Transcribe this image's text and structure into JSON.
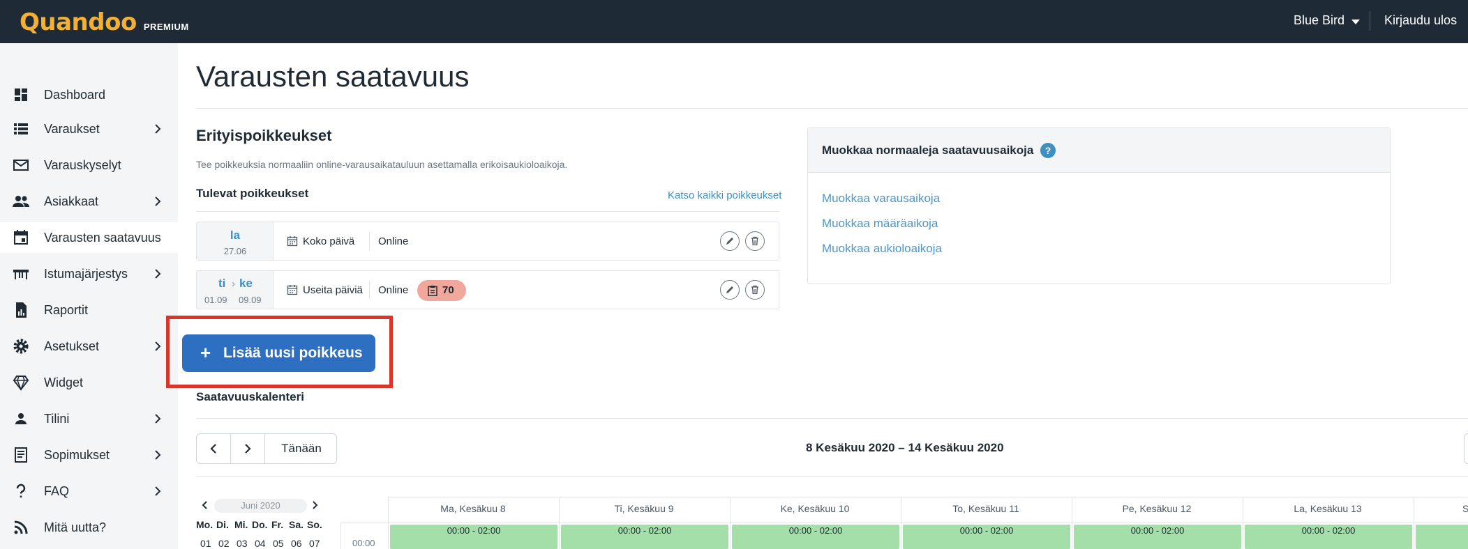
{
  "topbar": {
    "logo": "Quandoo",
    "logo_sub": "PREMIUM",
    "user": "Blue Bird",
    "logout": "Kirjaudu ulos"
  },
  "sidebar": {
    "items": [
      {
        "label": "Dashboard",
        "icon": "dashboard-icon",
        "chevron": false
      },
      {
        "label": "Varaukset",
        "icon": "list-icon",
        "chevron": true
      },
      {
        "label": "Varauskyselyt",
        "icon": "mail-icon",
        "chevron": false
      },
      {
        "label": "Asiakkaat",
        "icon": "people-icon",
        "chevron": true
      },
      {
        "label": "Varausten saatavuus",
        "icon": "calendar-icon",
        "chevron": false,
        "active": true
      },
      {
        "label": "Istumajärjestys",
        "icon": "table-icon",
        "chevron": true
      },
      {
        "label": "Raportit",
        "icon": "report-icon",
        "chevron": false
      },
      {
        "label": "Asetukset",
        "icon": "gear-icon",
        "chevron": true
      },
      {
        "label": "Widget",
        "icon": "diamond-icon",
        "chevron": false
      },
      {
        "label": "Tilini",
        "icon": "person-icon",
        "chevron": true
      },
      {
        "label": "Sopimukset",
        "icon": "document-icon",
        "chevron": true
      },
      {
        "label": "FAQ",
        "icon": "question-icon",
        "chevron": true
      },
      {
        "label": "Mitä uutta?",
        "icon": "rss-icon",
        "chevron": false
      }
    ]
  },
  "page": {
    "title": "Varausten saatavuus"
  },
  "exceptions": {
    "title": "Erityispoikkeukset",
    "description": "Tee poikkeuksia normaaliin online-varausaikatauluun asettamalla erikoisaukioloaikoja.",
    "upcoming_title": "Tulevat poikkeukset",
    "see_all": "Katso kaikki poikkeukset",
    "rows": [
      {
        "day": "la",
        "date": "27.06",
        "range_label": "Koko päivä",
        "channel": "Online"
      },
      {
        "day_start": "ti",
        "day_end": "ke",
        "date_start": "01.09",
        "date_end": "09.09",
        "arrow": "›",
        "range_label": "Useita päiviä",
        "channel": "Online",
        "badge": "70"
      }
    ],
    "add_plus": "+",
    "add_button": "Lisää uusi poikkeus"
  },
  "normal_hours": {
    "title": "Muokkaa normaaleja saatavuusaikoja",
    "help": "?",
    "links": [
      "Muokkaa varausaikoja",
      "Muokkaa määräaikoja",
      "Muokkaa aukioloaikoja"
    ]
  },
  "calendar": {
    "title": "Saatavuuskalenteri",
    "today": "Tänään",
    "range": "8 Kesäkuu 2020 – 14 Kesäkuu 2020",
    "mini_month": "Juni 2020",
    "weekdays": [
      "Mo.",
      "Di.",
      "Mi.",
      "Do.",
      "Fr.",
      "Sa.",
      "So."
    ],
    "days": [
      "01",
      "02",
      "03",
      "04",
      "05",
      "06",
      "07"
    ],
    "time_label": "00:00",
    "day_headers": [
      "Ma, Kesäkuu 8",
      "Ti, Kesäkuu 9",
      "Ke, Kesäkuu 10",
      "To, Kesäkuu 11",
      "Pe, Kesäkuu 12",
      "La, Kesäkuu 13",
      "S"
    ],
    "slot": "00:00 - 02:00",
    "colors": {
      "slot": "#a4dea8",
      "primary": "#2f6fc2",
      "highlight": "#d9362b",
      "topbar": "#1e2a36",
      "logo": "#f2b035"
    }
  }
}
